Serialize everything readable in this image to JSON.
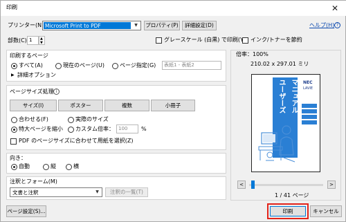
{
  "window": {
    "title": "印刷",
    "close_glyph": "✕"
  },
  "printer": {
    "label": "プリンター(N)：",
    "selected": "Microsoft Print to PDF",
    "properties_button": "プロパティ(P)",
    "advanced_button": "詳細設定(D)",
    "help_link": "ヘルプ(H)",
    "help_icon": "question-circle-icon"
  },
  "copies": {
    "label": "部数(C)：",
    "value": "1"
  },
  "options": {
    "grayscale_label": "グレースケール (白黒) で印刷(Y)",
    "grayscale_checked": false,
    "ink_save_label": "インク/トナーを節約",
    "ink_save_checked": false
  },
  "pages_to_print": {
    "section_label": "印刷するページ",
    "all_label": "すべて(A)",
    "current_label": "現在のページ(U)",
    "range_label": "ページ指定(G)",
    "range_placeholder": "表紙1 - 表紙2",
    "selected": "all",
    "more_options_label": "詳細オプション",
    "more_options_glyph": "▶"
  },
  "page_sizing": {
    "section_label": "ページサイズ処理",
    "tabs": [
      "サイズ(I)",
      "ポスター",
      "複数",
      "小冊子"
    ],
    "fit_label": "合わせる(F)",
    "actual_label": "実際のサイズ",
    "shrink_label": "特大ページを縮小",
    "custom_label": "カスタム倍率：",
    "custom_value": "100",
    "custom_unit": "%",
    "selected": "shrink",
    "paper_source_label": "PDF のページサイズに合わせて用紙を選択(Z)",
    "paper_source_checked": false
  },
  "orientation": {
    "section_label": "向き：",
    "auto_label": "自動",
    "portrait_label": "縦",
    "landscape_label": "横",
    "selected": "auto"
  },
  "comments": {
    "section_label": "注釈とフォーム(M)",
    "selected": "文書と注釈",
    "summary_button": "注釈の一覧(T)"
  },
  "preview": {
    "zoom_label": "倍率：100%",
    "dimensions": "210.02 x 297.01 ミリ",
    "page_indicator": "1 / 41 ページ",
    "prev_glyph": "<",
    "next_glyph": ">",
    "slider_fraction": 0.03,
    "doc_title_lines": [
      "ユーザーズ",
      "マニュアル"
    ],
    "doc_brand": "NEC",
    "doc_sub_brand": "LAVIE",
    "doc_color": "#2a7fd4"
  },
  "footer": {
    "page_setup_button": "ページ設定(S)...",
    "print_button": "印刷",
    "cancel_button": "キャンセル"
  },
  "colors": {
    "accent": "#0078d7",
    "highlight": "#e2231a",
    "link": "#0645ad"
  }
}
